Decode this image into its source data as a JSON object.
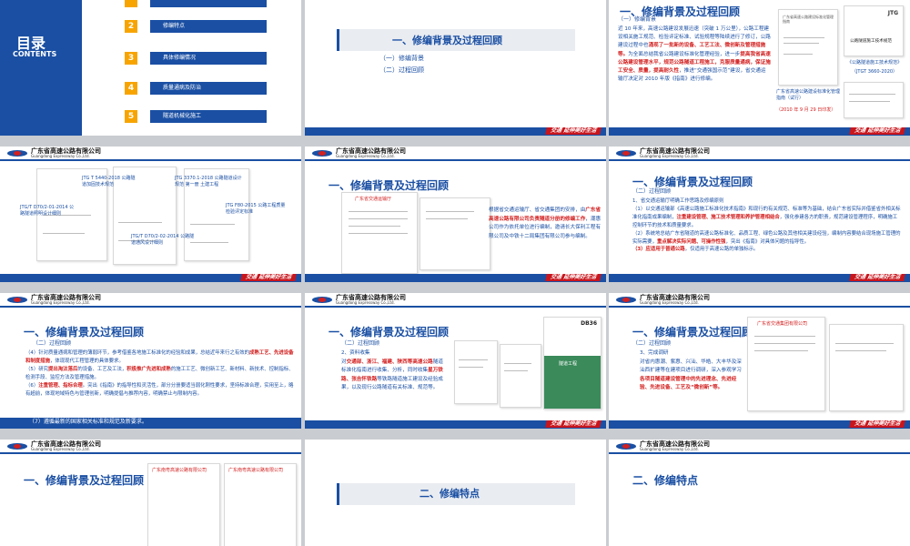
{
  "company": {
    "zh": "广东省高速公路有限公司",
    "en": "Guangdong Expressway Co.,Ltd."
  },
  "slogan": "交通 延伸美好生活",
  "colors": {
    "brand_blue": "#1a4fa3",
    "accent_red": "#d32020",
    "toc_orange": "#f7a400"
  },
  "toc": {
    "title": "目录",
    "title_en": "CONTENTS",
    "items": [
      {
        "num": "2",
        "label": "修编特点"
      },
      {
        "num": "3",
        "label": "具体修编情况"
      },
      {
        "num": "4",
        "label": "质量通病及防治"
      },
      {
        "num": "5",
        "label": "隧道机械化施工"
      }
    ]
  },
  "section_title": "一、修编背景及过程回顾",
  "section_title_2": "二、修编特点",
  "s2": {
    "items": [
      "（一）修编背景",
      "（二）过程回顾"
    ]
  },
  "s3": {
    "sub": "（一）修编背景",
    "text_a": "近 10 年来，高速公路建设发展迅速（突破 1 万公里），公路工程建设相关施工规范、检验评定标准、试验规程等陆续进行了修订，公路建设过程中也",
    "text_red": "涌现了一批新的设备、工艺工法、微创新及管理措施等。",
    "text_b": "为全面总结我省公路建设标准化管理经验，进一步",
    "text_red2": "提高我省高速公路建设管理水平，规范公路隧道工程施工，克服质量通病，保证施工安全、质量，提高耐久性",
    "text_c": "，推进“交通强国示范”建设，省交通运输厅决定对 2010 年版《指南》进行修编。",
    "doc_a_title": "广东省高速公路建设标准化管理指南（试行）",
    "doc_a_date": "（2010 年 9 月 29 日印发）",
    "doc_b_title": "《公路隧道施工技术规范》",
    "doc_b_code": "（JTGT 3660-2020）",
    "doc_b_heading": "公路隧道施工技术规范",
    "doc_a_head": "广东省高速公路建设标准化管理指南",
    "doc_b_mark": "JTG"
  },
  "s4": {
    "labels": [
      "JTG T 5440-2018 公路隧道加固技术规范",
      "JTG 3370.1-2018 公路隧道设计规范 第一册 土建工程",
      "JTG F80-2015 公路工程质量检验评定标准",
      "JTG/T D70/2-01-2014 公路隧道照明设计细则",
      "JTG/T D70/2-02-2014 公路隧道通风设计细则"
    ]
  },
  "s5": {
    "text_a": "根据省交通运输厅、省交通集团的安排，由",
    "text_red": "广东省高速公路有限公司负责隧道分册的修编工作",
    "text_b": "，潮惠公司作为依托单位进行编制，邀请长大保利工程有限公司及中铁十二局集团有限公司参与编制。",
    "doc_head": "广东省交通运输厅"
  },
  "s6": {
    "sub": "（二）过程回顾",
    "p1": "1、省交通运输厅明确工作思路及修编原则",
    "p2a": "（1）以交通运输部《高速公路施工标准化技术指南》和现行的有关规范、标准等为基础，结合广东省实际并借鉴省外相关标准化指南成果编制，",
    "p2red": "注重建设管理、施工技术管理和养护管理相结合",
    "p2b": "，强化参建各方的职责，规范建设管理程序，明确施工控制环节的技术和质量要求。",
    "p3a": "（2）系统地总结广东省隧道的高速公路标准化、品质工程、绿色公路及其他相关建设经验，编制内容要结合现场施工管理的实际需要，",
    "p3red": "重点解决实际问题、可操作性强",
    "p3b": "，突出《指南》对具体问题的指导性。",
    "p4red": "（3）应适用于普通公路",
    "p4b": "，仅适用于高速公路的单独标示。"
  },
  "s7": {
    "sub": "（二）过程回顾",
    "p1a": "（4）针对质量通病和管理的薄弱环节，参考借鉴各地施工标准化的经验和成果，总结近年来行之有效的",
    "p1red": "成熟工艺、先进设备和制度措施",
    "p1b": "，体现现代工程管理的具体要求。",
    "p2a": "（5）研究",
    "p2red": "提出淘汰落后",
    "p2b": "的设备、工艺及工法，",
    "p2red2": "积极推广先进和成熟",
    "p2c": "的施工工艺、微创新工艺、新材料、新技术、控制指标、检测手段、监控方法及管理措施。",
    "p3a": "（6）",
    "p3red": "注重管理、指标合理",
    "p3b": "。突出《指南》的指导性和灵活性，部分分册要适当弱化刚性要求，坚持标准合理，实用至上，略有超前，体现地域特色与管理创新，明确提倡与推荐内容，明确禁止与限制内容。",
    "p4": "（7）遵循最新的国家相关标准和规范及新要求。"
  },
  "s8": {
    "sub": "（二）过程回顾",
    "p1": "2、资料收集",
    "p2a": "对",
    "p2red": "交通部、浙江、福建、陕西等高速公路",
    "p2b": "隧道标准化指南进行收集、分析，同时收集",
    "p2red2": "星万铁路、张吉怀铁路",
    "p2c": "等铁路隧道施工建设及经验成果，以及现行公路隧道有关标准、规范等。",
    "doc_code": "DB36",
    "doc_title": "隧道工程"
  },
  "s9": {
    "sub": "（二）过程回顾",
    "p1": "3、完成调研",
    "p2a": "对省内惠潮、紫惠、兴汕、华皓、大丰华及深汕西扩建等在建项目进行调研，深入参观学习",
    "p2red": "各项目隧道建设管理中的先进理念、先进经验、先进设备、工艺及“微创新”等。",
    "doc_head": "广东省交通集团有限公司"
  },
  "s10": {
    "doc_a": "广东南粤高速公路有限公司",
    "doc_b": "广东南粤高速公路有限公司"
  },
  "s11": {
    "title": "二、修编特点"
  }
}
